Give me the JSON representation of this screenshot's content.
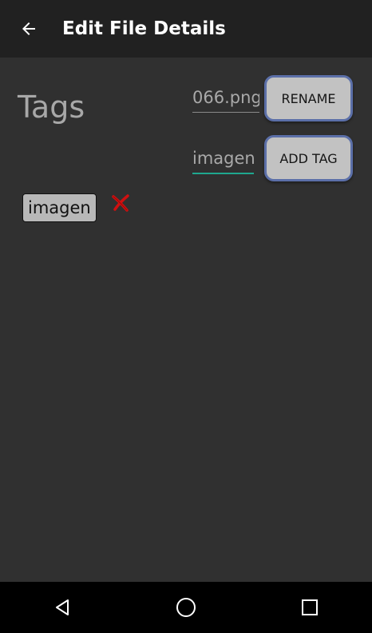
{
  "appbar": {
    "title": "Edit File Details",
    "back_icon": "arrow-back-icon"
  },
  "tags_section": {
    "label": "Tags"
  },
  "filename_field": {
    "value": "066.png"
  },
  "rename_button": {
    "label": "RENAME"
  },
  "tag_input": {
    "value": "imagen"
  },
  "add_tag_button": {
    "label": "ADD TAG"
  },
  "tags": [
    {
      "label": "imagen",
      "remove_icon": "red-x-icon"
    }
  ],
  "navbar": {
    "icons": [
      "back-triangle-icon",
      "home-circle-icon",
      "recents-square-icon"
    ]
  },
  "colors": {
    "appbar": "#212121",
    "background": "#303030",
    "accent": "#1fa78f",
    "button_fill": "#c2c2c2",
    "button_border": "#5b6fa8",
    "remove_icon": "#d01010"
  }
}
